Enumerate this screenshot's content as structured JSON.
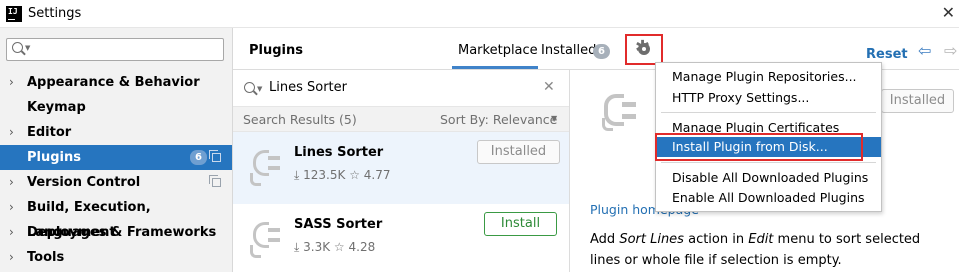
{
  "window": {
    "title": "Settings",
    "close_glyph": "✕"
  },
  "sidebar": {
    "search": {
      "value": "",
      "placeholder": ""
    },
    "items": [
      {
        "label": "Appearance & Behavior",
        "expandable": true,
        "selected": false
      },
      {
        "label": "Keymap",
        "expandable": false,
        "selected": false
      },
      {
        "label": "Editor",
        "expandable": true,
        "selected": false
      },
      {
        "label": "Plugins",
        "expandable": false,
        "selected": true,
        "badge": "6"
      },
      {
        "label": "Version Control",
        "expandable": true,
        "selected": false
      },
      {
        "label": "Build, Execution, Deployment",
        "expandable": true,
        "selected": false
      },
      {
        "label": "Languages & Frameworks",
        "expandable": true,
        "selected": false
      },
      {
        "label": "Tools",
        "expandable": true,
        "selected": false
      }
    ]
  },
  "header": {
    "title": "Plugins",
    "tabs": [
      {
        "label": "Marketplace",
        "active": true
      },
      {
        "label": "Installed",
        "active": false,
        "badge": "6"
      }
    ],
    "reset_label": "Reset",
    "back_glyph": "⇦",
    "forward_glyph": "⇨"
  },
  "plugin_search": {
    "value": "Lines Sorter",
    "clear_glyph": "✕"
  },
  "results": {
    "count_label": "Search Results (5)",
    "sort_label": "Sort By: Relevance"
  },
  "plugins": [
    {
      "name": "Lines Sorter",
      "downloads": "123.5K",
      "rating": "4.77",
      "button": "Installed",
      "selected": true
    },
    {
      "name": "SASS Sorter",
      "downloads": "3.3K",
      "rating": "4.28",
      "button": "Install",
      "selected": false
    }
  ],
  "detail": {
    "button": "Installed",
    "homepage_link": "Plugin homepage",
    "description": {
      "prefix": "Add ",
      "action": "Sort Lines",
      "middle": " action in ",
      "menu": "Edit",
      "suffix": " menu to sort selected lines or whole file if selection is empty."
    }
  },
  "gear_menu": {
    "items": [
      {
        "label": "Manage Plugin Repositories...",
        "highlighted": false
      },
      {
        "label": "HTTP Proxy Settings...",
        "highlighted": false
      },
      {
        "label": "Manage Plugin Certificates",
        "highlighted": false
      },
      {
        "label": "Install Plugin from Disk...",
        "highlighted": true
      },
      {
        "label": "Disable All Downloaded Plugins",
        "highlighted": false
      },
      {
        "label": "Enable All Downloaded Plugins",
        "highlighted": false
      }
    ]
  },
  "colors": {
    "selection": "#2675bf",
    "link": "#2470b3",
    "annotation": "#e12b2b",
    "install_green": "#2d8a37"
  },
  "icons": [
    "app-icon",
    "close-icon",
    "search-icon",
    "chevron-right-icon",
    "copy-icon",
    "gear-icon",
    "back-arrow-icon",
    "forward-arrow-icon",
    "clear-icon",
    "plug-icon",
    "download-icon",
    "star-icon"
  ]
}
